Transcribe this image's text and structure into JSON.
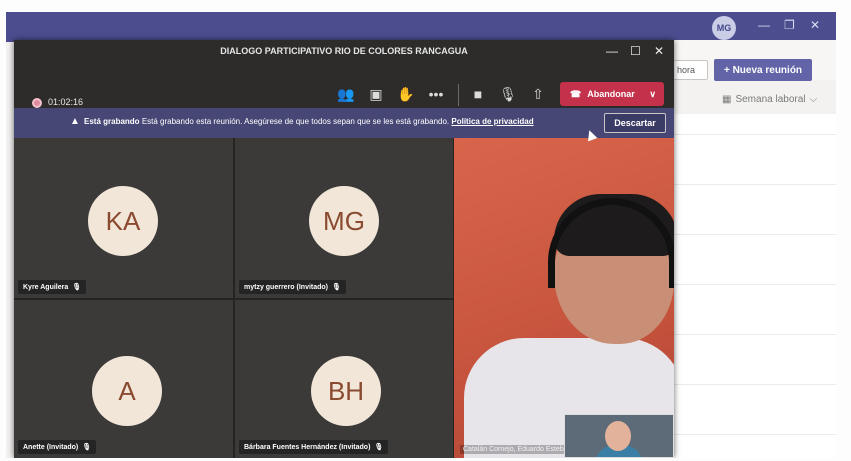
{
  "meeting": {
    "title": "DIALOGO PARTICIPATIVO RIO DE COLORES RANCAGUA",
    "timer": "01:02:16",
    "leave_label": "Abandonar",
    "toolbar_icons": [
      "participants-icon",
      "chat-icon",
      "raise-hand-icon",
      "more-icon",
      "camera-icon",
      "mic-muted-icon",
      "share-icon"
    ]
  },
  "banner": {
    "title": "Está grabando",
    "message": "Está grabando esta reunión. Asegúrese de que todos sepan que se les está grabando.",
    "link": "Política de privacidad",
    "discard_label": "Descartar"
  },
  "participants": [
    {
      "initials": "KA",
      "name": "Kyre Aguilera"
    },
    {
      "initials": "MG",
      "name": "mytzy guerrero (Invitado)"
    },
    {
      "initials": "A",
      "name": "Anette (Invitado)"
    },
    {
      "initials": "BH",
      "name": "Bárbara Fuentes Hernández (Invitado)"
    }
  ],
  "video_caption": "Catalán Cornejo, Eduardo Esteb",
  "background_app": {
    "today_label": "hora",
    "new_meeting_label": "+ Nueva reunión",
    "week_label": "Semana laboral",
    "avatar_initials": "MG"
  },
  "colors": {
    "leave": "#c4314b",
    "banner": "#464775",
    "teams_purple": "#6264a7"
  }
}
